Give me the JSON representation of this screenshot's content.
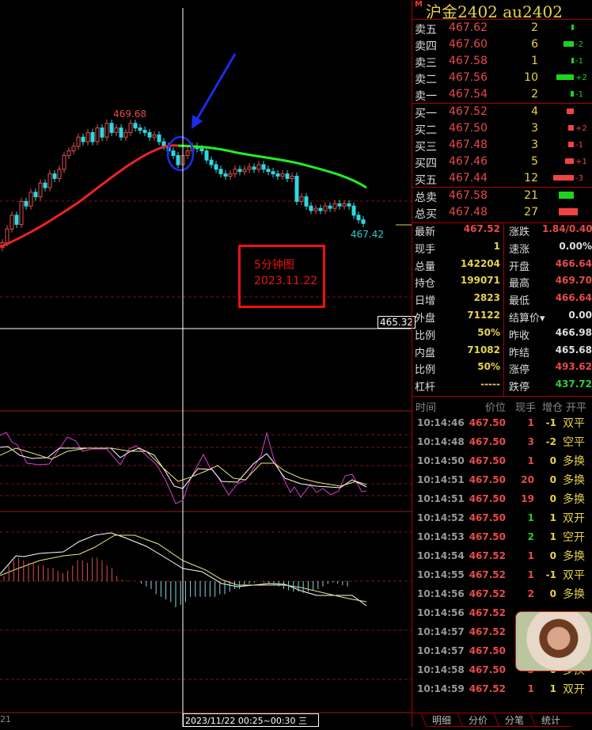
{
  "header": {
    "flag": "M",
    "title": "沪金2402  au2402"
  },
  "asks": [
    {
      "label": "卖五",
      "price": "467.62",
      "vol": "2",
      "delta": "",
      "bar": 1
    },
    {
      "label": "卖四",
      "price": "467.60",
      "vol": "6",
      "delta": "-2",
      "bar": 6
    },
    {
      "label": "卖三",
      "price": "467.58",
      "vol": "1",
      "delta": "-1",
      "bar": 1
    },
    {
      "label": "卖二",
      "price": "467.56",
      "vol": "10",
      "delta": "+2",
      "bar": 10
    },
    {
      "label": "卖一",
      "price": "467.54",
      "vol": "2",
      "delta": "-1",
      "bar": 2
    }
  ],
  "bids": [
    {
      "label": "买一",
      "price": "467.52",
      "vol": "4",
      "delta": "",
      "bar": 4
    },
    {
      "label": "买二",
      "price": "467.50",
      "vol": "3",
      "delta": "+2",
      "bar": 3
    },
    {
      "label": "买三",
      "price": "467.48",
      "vol": "3",
      "delta": "-1",
      "bar": 3
    },
    {
      "label": "买四",
      "price": "467.46",
      "vol": "5",
      "delta": "+1",
      "bar": 5
    },
    {
      "label": "买五",
      "price": "467.44",
      "vol": "12",
      "delta": "-3",
      "bar": 12
    }
  ],
  "totals": [
    {
      "label": "总卖",
      "price": "467.58",
      "vol": "21",
      "bar": 21
    },
    {
      "label": "总买",
      "price": "467.48",
      "vol": "27",
      "bar": 27
    }
  ],
  "stats": [
    {
      "l": "最新",
      "v": "467.52",
      "vc": "#e84a4a",
      "l2": "涨跌",
      "v2": "1.84/0.40%",
      "v2c": "#e84a4a"
    },
    {
      "l": "现手",
      "v": "1",
      "vc": "#e6d34a",
      "l2": "速涨",
      "v2": "0.00%",
      "v2c": "#ddd"
    },
    {
      "l": "总量",
      "v": "142204",
      "vc": "#e6d34a",
      "l2": "开盘",
      "v2": "466.64",
      "v2c": "#e84a4a"
    },
    {
      "l": "持仓",
      "v": "199071",
      "vc": "#e6d34a",
      "l2": "最高",
      "v2": "469.70",
      "v2c": "#e84a4a"
    },
    {
      "l": "日增",
      "v": "2823",
      "vc": "#e6d34a",
      "l2": "最低",
      "v2": "466.64",
      "v2c": "#e84a4a"
    },
    {
      "l": "外盘",
      "v": "71122",
      "vc": "#e6d34a",
      "l2": "结算价▾",
      "v2": "0.00",
      "v2c": "#ddd"
    },
    {
      "l": "比例",
      "v": "50%",
      "vc": "#e6d34a",
      "l2": "昨收",
      "v2": "466.98",
      "v2c": "#ddd"
    },
    {
      "l": "内盘",
      "v": "71082",
      "vc": "#e6d34a",
      "l2": "昨结",
      "v2": "465.68",
      "v2c": "#ddd"
    },
    {
      "l": "比例",
      "v": "50%",
      "vc": "#e6d34a",
      "l2": "涨停",
      "v2": "493.62",
      "v2c": "#e84a4a"
    },
    {
      "l": "杠杆",
      "v": "-----",
      "vc": "#e6d34a",
      "l2": "跌停",
      "v2": "437.72",
      "v2c": "#3c3"
    }
  ],
  "trades_header": [
    "时间",
    "价位",
    "现手",
    "增仓",
    "开平"
  ],
  "trades": [
    [
      "10:14:46",
      "467.50",
      "1",
      "-1",
      "双平",
      "r"
    ],
    [
      "10:14:48",
      "467.50",
      "3",
      "-2",
      "空平",
      "r"
    ],
    [
      "10:14:50",
      "467.50",
      "1",
      "0",
      "多换",
      "r"
    ],
    [
      "10:14:51",
      "467.50",
      "20",
      "0",
      "多换",
      "r"
    ],
    [
      "10:14:51",
      "467.50",
      "19",
      "0",
      "多换",
      "r"
    ],
    [
      "10:14:52",
      "467.50",
      "1",
      "1",
      "双开",
      "g"
    ],
    [
      "10:14:53",
      "467.50",
      "2",
      "1",
      "空开",
      "g"
    ],
    [
      "10:14:54",
      "467.52",
      "1",
      "0",
      "多换",
      "r"
    ],
    [
      "10:14:55",
      "467.52",
      "1",
      "-1",
      "双平",
      "r"
    ],
    [
      "10:14:56",
      "467.52",
      "2",
      "0",
      "多换",
      "r"
    ],
    [
      "10:14:56",
      "467.52",
      "",
      "",
      "",
      "r"
    ],
    [
      "10:14:57",
      "467.52",
      "",
      "",
      "",
      "r"
    ],
    [
      "10:14:57",
      "467.50",
      "",
      "",
      "",
      "r"
    ],
    [
      "10:14:58",
      "467.50",
      "3",
      "0",
      "多换",
      "r"
    ],
    [
      "10:14:59",
      "467.52",
      "1",
      "1",
      "双开",
      "r"
    ]
  ],
  "tabs": [
    "明细",
    "分价",
    "分笔",
    "统计"
  ],
  "chart": {
    "high_label": "469.68",
    "low_label": "467.42",
    "cross_price": "465.32",
    "note_line1": "5分钟图",
    "note_line2": "2023.11.22",
    "date_label": "2023/11/22 00:25~00:30 三",
    "left_axis": "21",
    "closes": [
      467.0,
      467.3,
      467.6,
      467.4,
      467.9,
      467.8,
      468.1,
      468.0,
      468.3,
      468.2,
      468.5,
      468.4,
      468.6,
      468.9,
      469.0,
      469.1,
      469.3,
      469.2,
      469.4,
      469.2,
      469.5,
      469.3,
      469.6,
      469.4,
      469.5,
      469.3,
      469.4,
      469.6,
      469.5,
      469.45,
      469.4,
      469.3,
      469.35,
      469.2,
      469.1,
      469.0,
      468.9,
      468.7,
      468.9,
      469.0,
      469.1,
      469.05,
      469.0,
      468.8,
      468.7,
      468.6,
      468.5,
      468.45,
      468.5,
      468.6,
      468.55,
      468.6,
      468.65,
      468.6,
      468.7,
      468.6,
      468.55,
      468.5,
      468.45,
      468.5,
      468.4,
      468.45,
      467.9,
      468.0,
      467.8,
      467.7,
      467.75,
      467.7,
      467.8,
      467.75,
      467.85,
      467.8,
      467.85,
      467.8,
      467.6,
      467.5,
      467.42
    ],
    "macd_hist": [
      0.2,
      0.6,
      0.8,
      0.9,
      0.8,
      0.7,
      0.7,
      0.6,
      0.6,
      0.5,
      0.5,
      0.4,
      0.3,
      0.4,
      0.6,
      0.8,
      0.8,
      0.7,
      0.9,
      0.9,
      0.8,
      0.6,
      0.5,
      0.2,
      0.05,
      0.02,
      0.01,
      0,
      -0.1,
      -0.2,
      -0.3,
      -0.5,
      -0.6,
      -0.7,
      -0.8,
      -1.0,
      -0.9,
      -0.8,
      -0.6,
      -0.6,
      -0.6,
      -0.6,
      -0.6,
      -0.6,
      -0.5,
      -0.5,
      -0.4,
      -0.3,
      -0.3,
      -0.2,
      -0.1,
      -0.05,
      0,
      -0.05,
      -0.1,
      -0.15,
      -0.2,
      -0.3,
      -0.35,
      -0.4,
      -0.4,
      -0.45,
      -0.4,
      -0.35,
      -0.3,
      -0.2,
      -0.1,
      -0.05,
      -0.1,
      -0.15,
      -0.2
    ]
  }
}
